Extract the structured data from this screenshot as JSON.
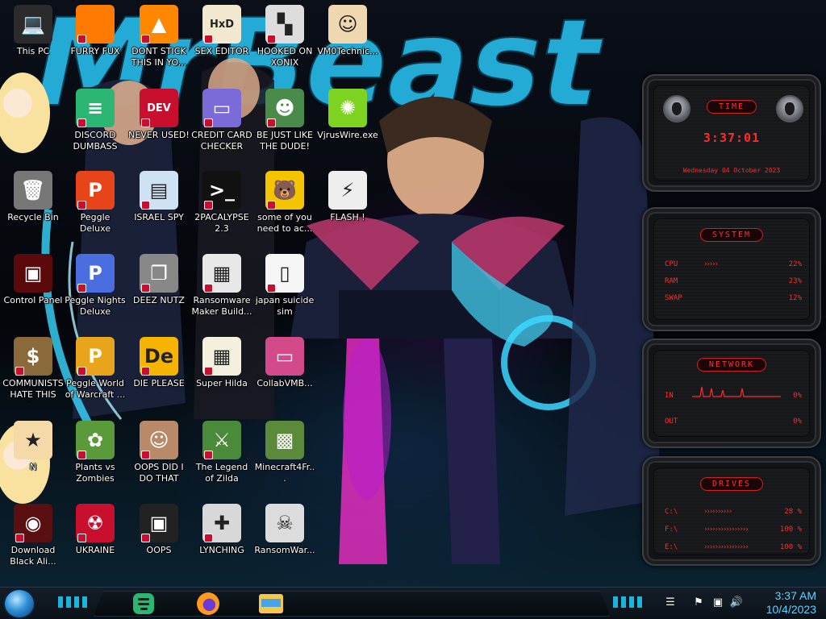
{
  "wallpaper": {
    "headline": "MrBeast"
  },
  "desktop_icons": [
    {
      "id": "this-pc",
      "label": "This PC",
      "glyph": "💻",
      "bg": "#2b2b2b",
      "col": 0,
      "row": 0,
      "shortcut": false
    },
    {
      "id": "furry-fux",
      "label": "FURRY FUX",
      "glyph": "",
      "bg": "#ff7a00",
      "col": 1,
      "row": 0,
      "shortcut": true
    },
    {
      "id": "dont-stick",
      "label": "DONT STICK THIS IN YO...",
      "glyph": "▲",
      "bg": "#ff8800",
      "col": 2,
      "row": 0,
      "shortcut": true
    },
    {
      "id": "sex-editor",
      "label": "SEX EDITOR",
      "glyph": "HxD",
      "bg": "#f2e8d0",
      "col": 3,
      "row": 0,
      "shortcut": true
    },
    {
      "id": "hooked-on-xonix",
      "label": "HOOKED ON XONIX",
      "glyph": "▚",
      "bg": "#ddd",
      "col": 4,
      "row": 0,
      "shortcut": true
    },
    {
      "id": "vm0technic",
      "label": "VM0Technic...",
      "glyph": "☺",
      "bg": "#f0d7b0",
      "col": 5,
      "row": 0,
      "shortcut": false
    },
    {
      "id": "discord",
      "label": "DISCORD DUMBASS",
      "glyph": "≡",
      "bg": "#2bb673",
      "col": 1,
      "row": 1,
      "shortcut": true
    },
    {
      "id": "never-used",
      "label": "NEVER USED!",
      "glyph": "DEV",
      "bg": "#c8102e",
      "col": 2,
      "row": 1,
      "shortcut": true
    },
    {
      "id": "credit-card",
      "label": "CREDIT CARD CHECKER",
      "glyph": "▭",
      "bg": "#7a6bd8",
      "col": 3,
      "row": 1,
      "shortcut": true
    },
    {
      "id": "be-just-like",
      "label": "BE JUST LIKE THE DUDE!",
      "glyph": "☻",
      "bg": "#4a8a4a",
      "col": 4,
      "row": 1,
      "shortcut": true
    },
    {
      "id": "vjruswire",
      "label": "VjrusWire.exe",
      "glyph": "✺",
      "bg": "#7ed321",
      "col": 5,
      "row": 1,
      "shortcut": false
    },
    {
      "id": "recycle-bin",
      "label": "Recycle Bin",
      "glyph": "🗑",
      "bg": "#777",
      "col": 0,
      "row": 2,
      "shortcut": false
    },
    {
      "id": "peggle-deluxe",
      "label": "Peggle Deluxe",
      "glyph": "P",
      "bg": "#e8441a",
      "col": 1,
      "row": 2,
      "shortcut": true
    },
    {
      "id": "israel-spy",
      "label": "ISRAEL SPY",
      "glyph": "▤",
      "bg": "#cfe2f3",
      "col": 2,
      "row": 2,
      "shortcut": true
    },
    {
      "id": "2pacalypse",
      "label": "2PACALYPSE 2.3",
      "glyph": ">_",
      "bg": "#111",
      "col": 3,
      "row": 2,
      "shortcut": true
    },
    {
      "id": "some-of-you",
      "label": "some of you need to ac...",
      "glyph": "🐻",
      "bg": "#f5c400",
      "col": 4,
      "row": 2,
      "shortcut": true
    },
    {
      "id": "flash",
      "label": "FLASH !",
      "glyph": "⚡",
      "bg": "#eee",
      "col": 5,
      "row": 2,
      "shortcut": false
    },
    {
      "id": "control-panel",
      "label": "Control Panel",
      "glyph": "▣",
      "bg": "#5a0a0a",
      "col": 0,
      "row": 3,
      "shortcut": false
    },
    {
      "id": "peggle-nights",
      "label": "Peggle Nights Deluxe",
      "glyph": "P",
      "bg": "#4a6ee0",
      "col": 1,
      "row": 3,
      "shortcut": true
    },
    {
      "id": "deez-nutz",
      "label": "DEEZ NUTZ",
      "glyph": "❐",
      "bg": "#888",
      "col": 2,
      "row": 3,
      "shortcut": true
    },
    {
      "id": "ransomware-maker",
      "label": "Ransomware Maker Build...",
      "glyph": "▦",
      "bg": "#e8e8e8",
      "col": 3,
      "row": 3,
      "shortcut": true
    },
    {
      "id": "japan-suicide",
      "label": "japan suicide sim",
      "glyph": "▯",
      "bg": "#f5f5f5",
      "col": 4,
      "row": 3,
      "shortcut": true
    },
    {
      "id": "communists",
      "label": "COMMUNISTS HATE THIS G...",
      "glyph": "$",
      "bg": "#8a6a3a",
      "col": 0,
      "row": 4,
      "shortcut": true
    },
    {
      "id": "peggle-world",
      "label": "Peggle World of Warcraft ...",
      "glyph": "P",
      "bg": "#e8a41a",
      "col": 1,
      "row": 4,
      "shortcut": true
    },
    {
      "id": "die-please",
      "label": "DIE PLEASE",
      "glyph": "De",
      "bg": "#f5b400",
      "col": 2,
      "row": 4,
      "shortcut": true
    },
    {
      "id": "super-hilda",
      "label": "Super Hilda",
      "glyph": "▦",
      "bg": "#f3f0dd",
      "col": 3,
      "row": 4,
      "shortcut": true
    },
    {
      "id": "collabvmb",
      "label": "CollabVMB...",
      "glyph": "▭",
      "bg": "#d24a8a",
      "col": 4,
      "row": 4,
      "shortcut": false
    },
    {
      "id": "star-n",
      "label": "N",
      "glyph": "★",
      "bg": "#f6d9a8",
      "col": 0,
      "row": 5,
      "shortcut": false
    },
    {
      "id": "plants-vs-zombies",
      "label": "Plants vs Zombies",
      "glyph": "✿",
      "bg": "#5a9a3a",
      "col": 1,
      "row": 5,
      "shortcut": true
    },
    {
      "id": "oops-did-i",
      "label": "OOPS DID I DO THAT",
      "glyph": "☺",
      "bg": "#b88a6a",
      "col": 2,
      "row": 5,
      "shortcut": true
    },
    {
      "id": "legend-of-zilda",
      "label": "The Legend of Zilda",
      "glyph": "⚔",
      "bg": "#4a8a3a",
      "col": 3,
      "row": 5,
      "shortcut": true
    },
    {
      "id": "minecraft4fr",
      "label": "Minecraft4Fr...",
      "glyph": "▩",
      "bg": "#5a8a3a",
      "col": 4,
      "row": 5,
      "shortcut": false
    },
    {
      "id": "download-black-ali",
      "label": "Download Black Ali...",
      "glyph": "◉",
      "bg": "#5a1010",
      "col": 0,
      "row": 6,
      "shortcut": true
    },
    {
      "id": "ukraine",
      "label": "UKRAINE",
      "glyph": "☢",
      "bg": "#c8102e",
      "col": 1,
      "row": 6,
      "shortcut": true
    },
    {
      "id": "oops",
      "label": "OOPS",
      "glyph": "▣",
      "bg": "#222",
      "col": 2,
      "row": 6,
      "shortcut": true
    },
    {
      "id": "lynching",
      "label": "LYNCHING",
      "glyph": "✚",
      "bg": "#d8d8d8",
      "col": 3,
      "row": 6,
      "shortcut": true
    },
    {
      "id": "ransomwar",
      "label": "RansomWar...",
      "glyph": "☠",
      "bg": "#dcdcdc",
      "col": 4,
      "row": 6,
      "shortcut": false
    }
  ],
  "widget": {
    "time": {
      "title": "TIME",
      "clock": "3:37:01",
      "date": "Wednesday 04 October 2023"
    },
    "system": {
      "title": "SYSTEM",
      "rows": [
        {
          "key": "CPU",
          "value": "22%",
          "fill": 0.22
        },
        {
          "key": "RAM",
          "value": "23%",
          "fill": 0.23
        },
        {
          "key": "SWAP",
          "value": "12%",
          "fill": 0.12
        }
      ]
    },
    "network": {
      "title": "NETWORK",
      "rows": [
        {
          "key": "IN",
          "value": "0%"
        },
        {
          "key": "OUT",
          "value": "0%"
        }
      ]
    },
    "drives": {
      "title": "DRIVES",
      "rows": [
        {
          "key": "C:\\",
          "value": "28 %"
        },
        {
          "key": "F:\\",
          "value": "100 %"
        },
        {
          "key": "E:\\",
          "value": "100 %"
        }
      ]
    }
  },
  "taskbar": {
    "apps": [
      {
        "id": "discord",
        "name": "discord-app-icon",
        "bg": "#2bb673"
      },
      {
        "id": "firefox",
        "name": "firefox-app-icon",
        "bg": "#ff7a00"
      },
      {
        "id": "explorer",
        "name": "file-explorer-app-icon",
        "bg": "#f5c84a"
      }
    ],
    "clock_time": "3:37 AM",
    "clock_date": "10/4/2023"
  }
}
